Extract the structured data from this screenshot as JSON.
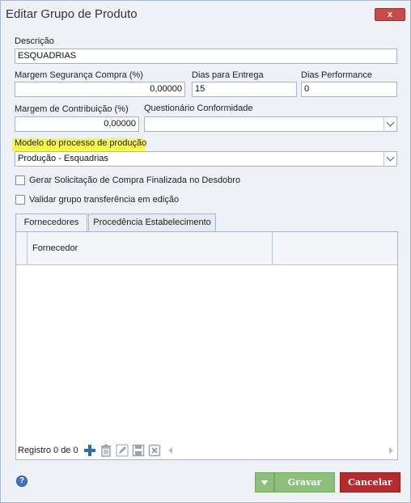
{
  "window": {
    "title": "Editar Grupo de Produto",
    "close_label": "x"
  },
  "form": {
    "descricao": {
      "label": "Descrição",
      "value": "ESQUADRIAS"
    },
    "margem_seguranca": {
      "label": "Margem Segurança Compra (%)",
      "value": "0,00000"
    },
    "dias_entrega": {
      "label": "Dias para Entrega",
      "value": "15"
    },
    "dias_performance": {
      "label": "Dias Performance",
      "value": "0"
    },
    "margem_contribuicao": {
      "label": "Margem de Contribuição (%)",
      "value": "0,00000"
    },
    "questionario": {
      "label": "Questionário Conformidade",
      "value": ""
    },
    "modelo_processo": {
      "label": "Modelo do processo de produção",
      "value": "Produção - Esquadrias"
    },
    "gerar_solicitacao": {
      "label": "Gerar Solicitação de Compra Finalizada no Desdobro",
      "checked": false
    },
    "validar_grupo": {
      "label": "Validar grupo transferência em edição",
      "checked": false
    }
  },
  "tabs": [
    {
      "label": "Fornecedores",
      "active": true
    },
    {
      "label": "Procedência Estabelecimento",
      "active": false
    }
  ],
  "grid": {
    "columns": [
      "Fornecedor",
      ""
    ],
    "rows": [],
    "pager_text": "Registro 0 de 0",
    "pager_icons": [
      "add-icon",
      "delete-icon",
      "edit-icon",
      "save-icon",
      "cancel-edit-icon"
    ]
  },
  "footer": {
    "help_label": "?",
    "save_label": "Gravar",
    "cancel_label": "Cancelar"
  },
  "colors": {
    "highlight": "#f6f84a",
    "save_green": "#8dc07a",
    "cancel_red": "#b42a2d",
    "close_red": "#c74a48"
  }
}
